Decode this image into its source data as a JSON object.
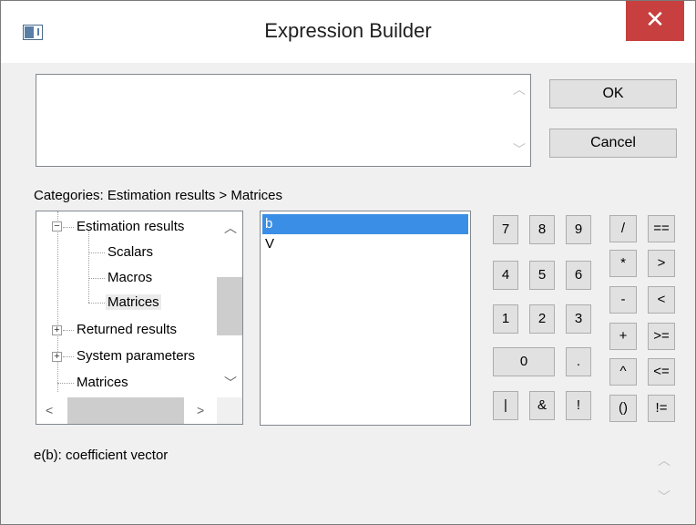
{
  "window": {
    "title": "Expression Builder",
    "close_glyph": "✕"
  },
  "expression": {
    "value": ""
  },
  "buttons": {
    "ok": "OK",
    "cancel": "Cancel"
  },
  "categories": {
    "label": "Categories: Estimation results > Matrices",
    "tree": [
      {
        "label": "Estimation results",
        "expander": "−"
      },
      {
        "label": "Scalars"
      },
      {
        "label": "Macros"
      },
      {
        "label": "Matrices",
        "selected": true
      },
      {
        "label": "Returned results",
        "expander": "+"
      },
      {
        "label": "System parameters",
        "expander": "+"
      },
      {
        "label": "Matrices"
      }
    ]
  },
  "list": {
    "items": [
      "b",
      "V"
    ],
    "selected_index": 0
  },
  "keypad": {
    "digits": [
      "7",
      "8",
      "9",
      "4",
      "5",
      "6",
      "1",
      "2",
      "3"
    ],
    "zero": "0",
    "dot": ".",
    "logic": [
      "|",
      "&",
      "!"
    ]
  },
  "operators": [
    "/",
    "==",
    "*",
    ">",
    "-",
    "<",
    "+",
    ">=",
    "^",
    "<=",
    "()",
    "!="
  ],
  "description": "e(b):  coefficient vector",
  "icons": {
    "app": "app-window-icon",
    "scroll_up": "chevron-up-icon",
    "scroll_down": "chevron-down-icon",
    "scroll_left": "chevron-left-icon",
    "scroll_right": "chevron-right-icon"
  },
  "colors": {
    "close": "#c7403f",
    "selection": "#3a8ee6"
  }
}
